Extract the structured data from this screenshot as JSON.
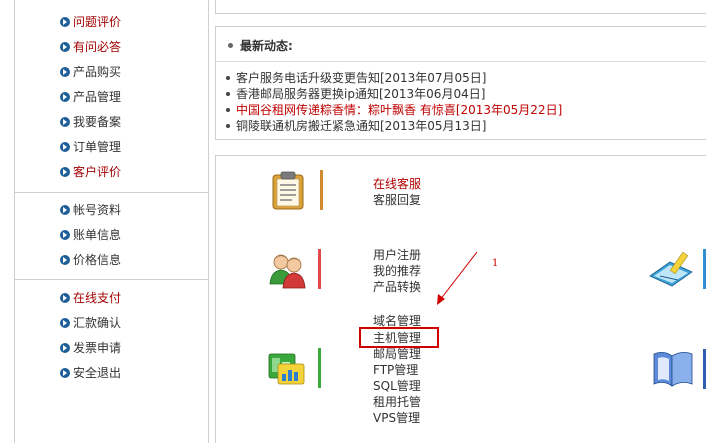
{
  "sidebar": {
    "group1": [
      {
        "label": "问题评价",
        "red": true
      },
      {
        "label": "有问必答",
        "red": true
      },
      {
        "label": "产品购买",
        "red": false
      },
      {
        "label": "产品管理",
        "red": false
      },
      {
        "label": "我要备案",
        "red": false
      },
      {
        "label": "订单管理",
        "red": false
      },
      {
        "label": "客户评价",
        "red": true
      }
    ],
    "group2": [
      {
        "label": "帐号资料",
        "red": false
      },
      {
        "label": "账单信息",
        "red": false
      },
      {
        "label": "价格信息",
        "red": false
      }
    ],
    "group3": [
      {
        "label": "在线支付",
        "red": true
      },
      {
        "label": "汇款确认",
        "red": false
      },
      {
        "label": "发票申请",
        "red": false
      },
      {
        "label": "安全退出",
        "red": false
      }
    ]
  },
  "news": {
    "title": "最新动态:",
    "items": [
      {
        "text": "客户服务电话升级变更告知[2013年07月05日]",
        "red": false
      },
      {
        "text": "香港邮局服务器更换ip通知[2013年06月04日]",
        "red": false
      },
      {
        "text": "中国谷租网传递粽香情：粽叶飘香 有惊喜[2013年05月22日]",
        "red": true
      },
      {
        "text": "铜陵联通机房搬迁紧急通知[2013年05月13日]",
        "red": false
      }
    ]
  },
  "services": {
    "support": [
      "在线客服",
      "客服回复"
    ],
    "account": [
      "用户注册",
      "我的推荐",
      "产品转换"
    ],
    "hosting": [
      "域名管理",
      "主机管理",
      "邮局管理",
      "FTP管理",
      "SQL管理",
      "租用托管",
      "VPS管理"
    ]
  },
  "annotation": {
    "number": "1"
  },
  "colors": {
    "accent_red": "#b00000",
    "link_blue": "#1f5f98",
    "border": "#cfcfcf",
    "highlight": "#d00000"
  }
}
